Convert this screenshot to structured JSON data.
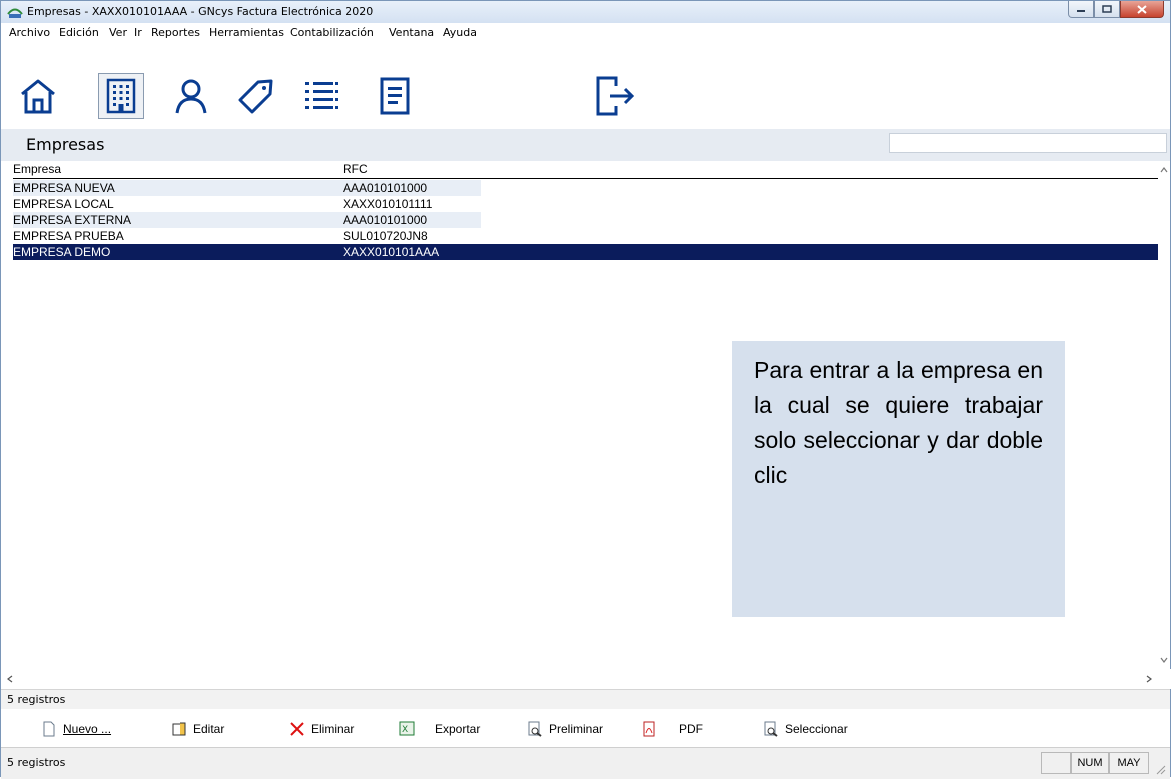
{
  "window": {
    "title": "Empresas - XAXX010101AAA - GNcys Factura Electrónica 2020"
  },
  "menu": [
    "Archivo",
    "Edición",
    "Ver",
    "Ir",
    "Reportes",
    "Herramientas",
    "Contabilización",
    "Ventana",
    "Ayuda"
  ],
  "toolbar": {
    "icons": [
      "home-icon",
      "building-icon",
      "user-icon",
      "tag-icon",
      "list-icon",
      "document-icon",
      "exit-icon"
    ],
    "active": "building-icon"
  },
  "header": {
    "title": "Empresas",
    "search_value": ""
  },
  "grid": {
    "columns": [
      "Empresa",
      "RFC"
    ],
    "rows": [
      [
        "EMPRESA NUEVA",
        "AAA010101000"
      ],
      [
        "EMPRESA LOCAL",
        "XAXX010101111"
      ],
      [
        "EMPRESA EXTERNA",
        "AAA010101000"
      ],
      [
        "EMPRESA PRUEBA",
        "SUL010720JN8"
      ],
      [
        "EMPRESA DEMO",
        "XAXX010101AAA"
      ]
    ],
    "selected_row": 4
  },
  "note": "Para entrar a la empresa en la cual se quiere trabajar solo seleccionar y dar doble clic",
  "record_count": "5 registros",
  "actions": {
    "nuevo": "Nuevo ...",
    "editar": "Editar",
    "eliminar": "Eliminar",
    "exportar": "Exportar",
    "preliminar": "Preliminar",
    "pdf": "PDF",
    "seleccionar": "Seleccionar"
  },
  "status": {
    "text": "5 registros",
    "num": "NUM",
    "may": "MAY"
  },
  "colors": {
    "selected_row": "#0b1c5c",
    "alt_row": "#e8eef6",
    "note_bg": "#d6e0ed",
    "header_bg": "#e6ebf2",
    "icon_blue": "#0a3d91"
  }
}
